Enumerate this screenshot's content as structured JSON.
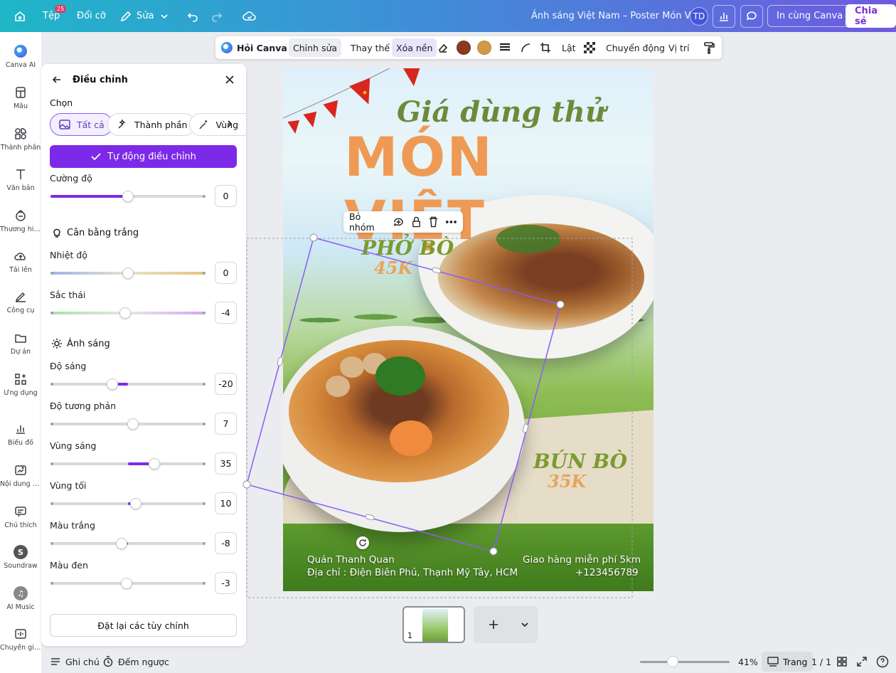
{
  "topbar": {
    "file_label": "Tệp",
    "file_badge": "25",
    "resize_label": "Đổi cỡ",
    "edit_label": "Sửa",
    "doc_title": "Ảnh sáng Việt Nam – Poster Món Việt",
    "avatar_initials": "TD",
    "print_label": "In cùng Canva",
    "share_label": "Chia sẻ"
  },
  "rail": [
    {
      "label": "Canva AI",
      "icon": "canva-ai-icon"
    },
    {
      "label": "Mẫu",
      "icon": "templates-icon"
    },
    {
      "label": "Thành phần",
      "icon": "elements-icon"
    },
    {
      "label": "Văn bản",
      "icon": "text-icon"
    },
    {
      "label": "Thương hiệu",
      "icon": "brand-icon"
    },
    {
      "label": "Tải lên",
      "icon": "upload-icon"
    },
    {
      "label": "Công cụ",
      "icon": "tools-icon"
    },
    {
      "label": "Dự án",
      "icon": "projects-icon"
    },
    {
      "label": "Ứng dụng",
      "icon": "apps-icon"
    },
    {
      "label": "Biểu đồ",
      "icon": "charts-icon"
    },
    {
      "label": "Nội dung M...",
      "icon": "magic-media-icon"
    },
    {
      "label": "Chú thích",
      "icon": "captions-icon"
    },
    {
      "label": "Soundraw",
      "icon": "soundraw-icon"
    },
    {
      "label": "AI Music",
      "icon": "ai-music-icon"
    },
    {
      "label": "Chuyển giọ...",
      "icon": "voice-icon"
    }
  ],
  "panel": {
    "title": "Điều chỉnh",
    "select_label": "Chọn",
    "chips": [
      "Tất cả",
      "Thành phần",
      "Vùng"
    ],
    "auto_label": "Tự động điều chỉnh",
    "intensity": {
      "label": "Cường độ",
      "value": "0",
      "level": 0.5
    },
    "white_balance_title": "Cân bằng trắng",
    "light_title": "Ánh sáng",
    "sliders": [
      {
        "key": "temperature",
        "label": "Nhiệt độ",
        "value": "0",
        "level": 0.5
      },
      {
        "key": "tint",
        "label": "Sắc thái",
        "value": "-4",
        "level": 0.48
      },
      {
        "key": "brightness",
        "label": "Độ sáng",
        "value": "-20",
        "level": 0.4
      },
      {
        "key": "contrast",
        "label": "Độ tương phản",
        "value": "7",
        "level": 0.53
      },
      {
        "key": "highlights",
        "label": "Vùng sáng",
        "value": "35",
        "level": 0.67
      },
      {
        "key": "shadows",
        "label": "Vùng tối",
        "value": "10",
        "level": 0.55
      },
      {
        "key": "whites",
        "label": "Màu trắng",
        "value": "-8",
        "level": 0.46
      },
      {
        "key": "blacks",
        "label": "Màu đen",
        "value": "-3",
        "level": 0.49
      }
    ],
    "reset_label": "Đặt lại các tùy chỉnh"
  },
  "context_toolbar": {
    "ask_label": "Hỏi Canva",
    "edit_label": "Chỉnh sửa",
    "replace_label": "Thay thế",
    "bg_remove_label": "Xóa nền",
    "color1": "#8b3a1e",
    "color2": "#d39a45",
    "flip_label": "Lật",
    "animate_label": "Chuyển động",
    "position_label": "Vị trí"
  },
  "poster": {
    "subtitle": "Giá dùng thử",
    "title": "MÓN VIỆT",
    "dish1": "PHỞ BÒ",
    "price1": "45K",
    "dish2": "BÚN BÒ",
    "price2": "35K",
    "shop": "Quán Thanh Quan",
    "address": "Địa chỉ : Điện Biên Phủ, Thạnh Mỹ Tây, HCM",
    "delivery": "Giao hàng miễn phí 5km",
    "phone": "+123456789"
  },
  "group_toolbar": {
    "ungroup_label": "Bỏ nhóm"
  },
  "pages": {
    "thumb_number": "1"
  },
  "bottombar": {
    "notes_label": "Ghi chú",
    "timer_label": "Đếm ngược",
    "zoom": "41%",
    "pages_label": "Trang",
    "page_count": "1 / 1"
  }
}
